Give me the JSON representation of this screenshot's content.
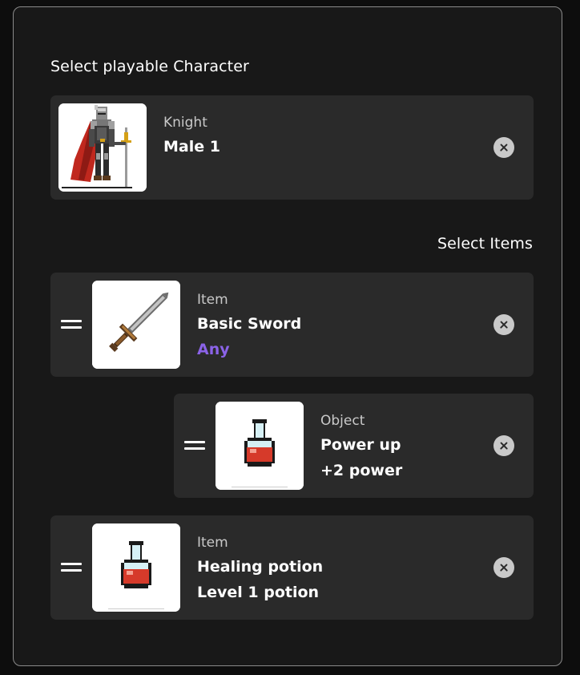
{
  "theme": {
    "background": "#181818",
    "card": "#2a2a2a",
    "accent": "#8b63e8",
    "close_icon_bg": "#c9c9c9"
  },
  "character_section": {
    "title": "Select playable Character",
    "character": {
      "kind": "Knight",
      "name": "Male 1",
      "icon": "knight-sprite"
    }
  },
  "items_section": {
    "title": "Select Items",
    "items": [
      {
        "kind": "Item",
        "name": "Basic Sword",
        "detail": "Any",
        "icon": "sword-sprite"
      },
      {
        "kind": "Object",
        "name": "Power up",
        "detail": "+2 power",
        "icon": "potion-sprite"
      },
      {
        "kind": "Item",
        "name": "Healing potion",
        "detail": "Level 1 potion",
        "icon": "potion-sprite"
      }
    ]
  }
}
